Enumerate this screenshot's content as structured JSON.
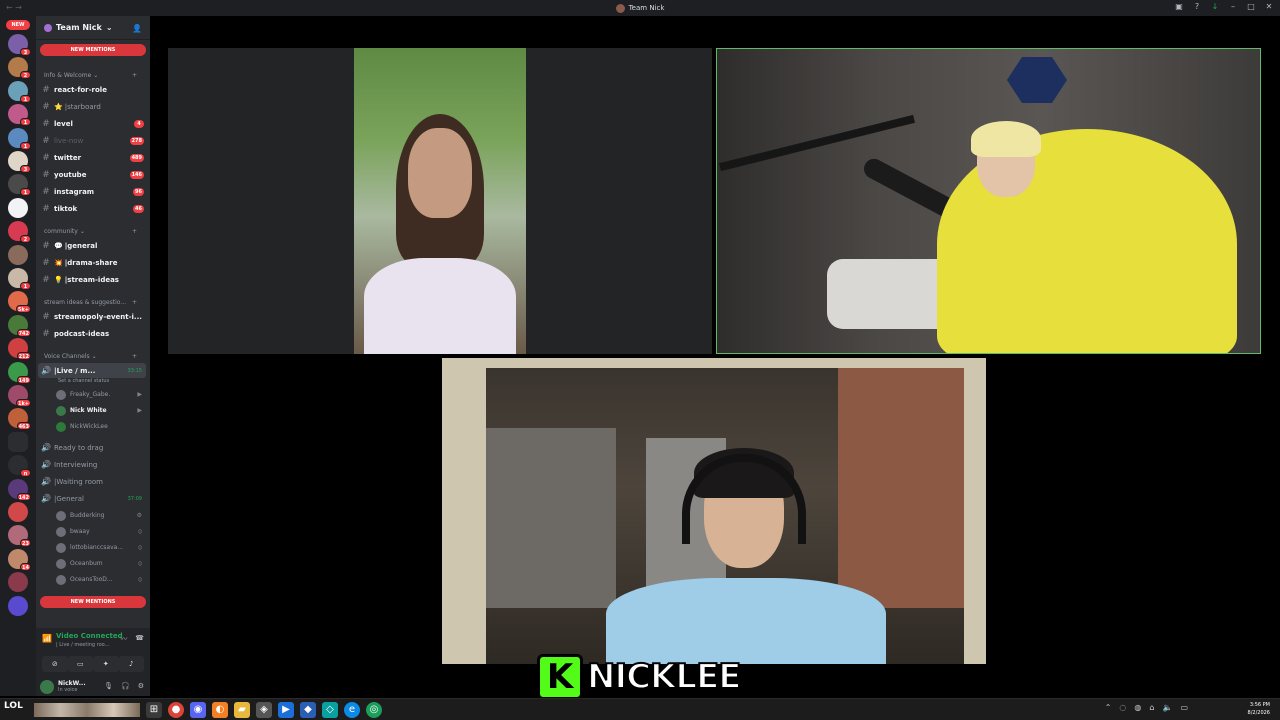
{
  "window": {
    "title": "Team Nick"
  },
  "rail": {
    "new_label": "NEW",
    "badges": [
      "3",
      "2",
      "1",
      "1",
      "1",
      "3",
      "1",
      "",
      "2",
      "",
      "1",
      "5k+",
      "742",
      "212",
      "149",
      "1k+",
      "463",
      "",
      "n",
      "142",
      "",
      "23",
      "14",
      "",
      ""
    ]
  },
  "server": {
    "name": "Team Nick",
    "new_mentions_top": "NEW MENTIONS",
    "new_mentions_bottom": "NEW MENTIONS"
  },
  "categories": {
    "info": "Info & Welcome",
    "community": "community",
    "ideas": "stream ideas & suggestio...",
    "voice": "Voice Channels"
  },
  "channels": [
    {
      "name": "react-for-role",
      "count": ""
    },
    {
      "name": "starboard",
      "count": "",
      "emoji": "⭐"
    },
    {
      "name": "level",
      "count": "4"
    },
    {
      "name": "live-now",
      "count": "278"
    },
    {
      "name": "twitter",
      "count": "489"
    },
    {
      "name": "youtube",
      "count": "146"
    },
    {
      "name": "instagram",
      "count": "96"
    },
    {
      "name": "tiktok",
      "count": "46"
    },
    {
      "name": "general",
      "emoji": "💬"
    },
    {
      "name": "drama-share",
      "emoji": "💥"
    },
    {
      "name": "stream-ideas",
      "emoji": "💡"
    },
    {
      "name": "streamopoly-event-i..."
    },
    {
      "name": "podcast-ideas"
    }
  ],
  "voice_channels": {
    "live": {
      "name": "Live / m...",
      "timer": "33:15",
      "status": "Set a channel status"
    },
    "live_users": [
      "Freaky_Gabe.",
      "Nick White",
      "NickWickLee"
    ],
    "ready": "Ready to drag",
    "interviewing": "Interviewing",
    "waiting": "Waiting room",
    "general": {
      "name": "General",
      "timer": "37:09"
    },
    "general_users": [
      "Budderking",
      "bwaay",
      "lottobianccsava...",
      "Oceanbum",
      "OceansTooD..."
    ]
  },
  "voice_panel": {
    "status": "Video Connected",
    "channel": "Live / meeting roo..."
  },
  "user": {
    "name": "NickW...",
    "status": "In voice"
  },
  "overlay": {
    "name": "NICKLEE",
    "logo": "K"
  },
  "taskbar": {
    "lol": "LOL",
    "time": "3:56 PM",
    "date": "8/2/2026"
  }
}
